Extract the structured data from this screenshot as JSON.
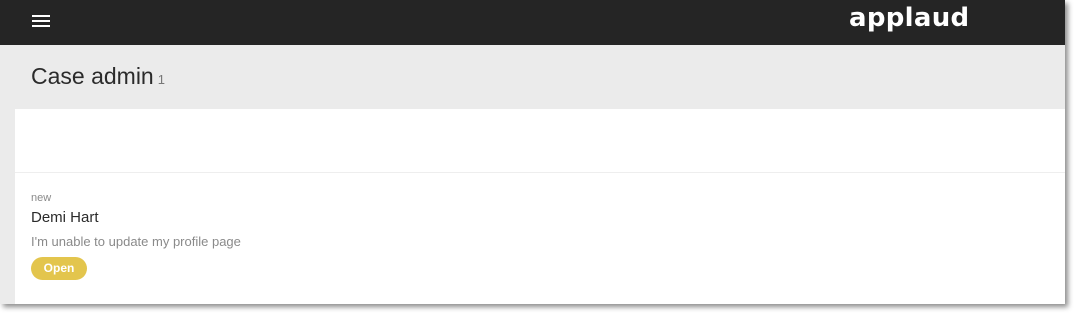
{
  "topbar": {
    "menu_icon": "hamburger-menu-icon",
    "logo_text": "applaud",
    "background": "#252525"
  },
  "header": {
    "title": "Case admin",
    "count": "1"
  },
  "cases": [
    {
      "tag": "new",
      "name": "Demi Hart",
      "description": "I'm unable to update my profile page",
      "status": "Open",
      "status_color": "#e3c54d"
    }
  ]
}
